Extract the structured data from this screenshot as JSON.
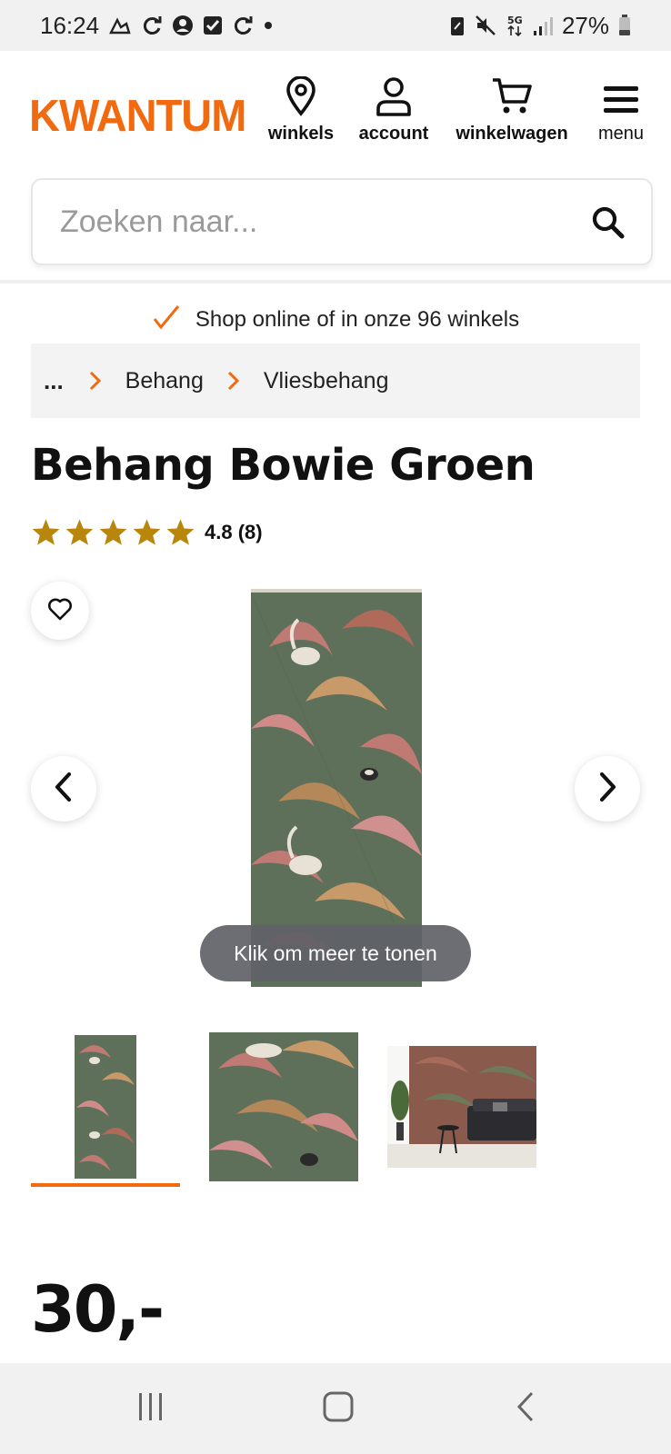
{
  "status_bar": {
    "time": "16:24",
    "battery": "27%",
    "network": "5G",
    "left_icons": [
      "pedometer-icon",
      "sync-icon",
      "account-circle-icon",
      "checkbox-icon",
      "sync-icon",
      "dot-icon"
    ],
    "right_icons": [
      "battery-saver-icon",
      "mute-icon",
      "5g-icon",
      "signal-icon",
      "battery-icon"
    ]
  },
  "header": {
    "logo": "KWANTUM",
    "nav": {
      "winkels": "winkels",
      "account": "account",
      "cart": "winkelwagen",
      "menu": "menu"
    }
  },
  "search": {
    "placeholder": "Zoeken naar..."
  },
  "usp": {
    "text": "Shop online of in onze 96 winkels"
  },
  "breadcrumb": {
    "ellipsis": "...",
    "items": [
      "Behang",
      "Vliesbehang"
    ]
  },
  "product": {
    "title": "Behang Bowie Groen",
    "rating": {
      "stars": 5,
      "text": "4.8 (8)"
    },
    "gallery": {
      "more_label": "Klik om meer te tonen",
      "thumbnail_count": 3,
      "selected_thumbnail": 1
    },
    "price": "30,-"
  },
  "colors": {
    "brand_orange": "#f26a10",
    "star_gold": "#b8860b",
    "wallpaper_green": "#5e6f5a",
    "wallpaper_pink": "#c07a74"
  }
}
